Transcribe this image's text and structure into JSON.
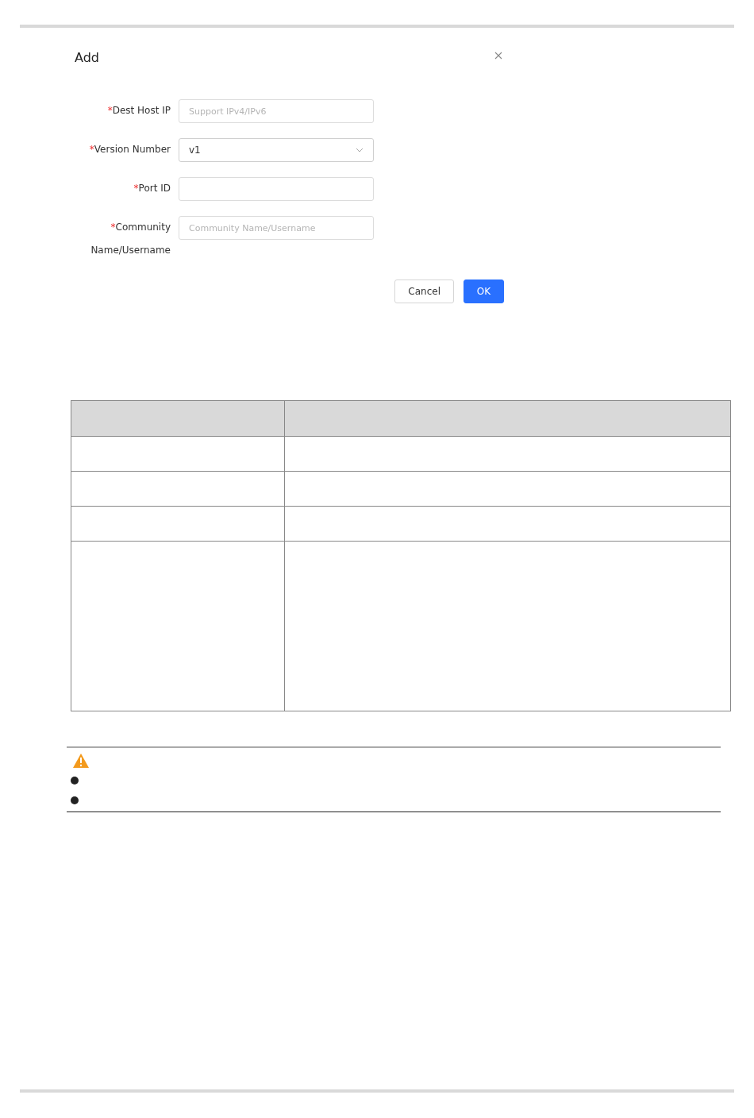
{
  "dialog": {
    "title": "Add",
    "fields": [
      {
        "kind": "text",
        "label": "Dest Host IP",
        "required_mark": "*",
        "placeholder": "Support IPv4/IPv6"
      },
      {
        "kind": "select",
        "label": "Version Number",
        "required_mark": "*",
        "value": "v1"
      },
      {
        "kind": "text",
        "label": "Port ID",
        "required_mark": "*"
      },
      {
        "kind": "text",
        "label": "Community Name/Username",
        "required_mark": "*",
        "placeholder": "Community Name/Username"
      }
    ],
    "buttons": [
      {
        "label": "Cancel",
        "primary": false
      },
      {
        "label": "OK",
        "primary": true
      }
    ]
  }
}
